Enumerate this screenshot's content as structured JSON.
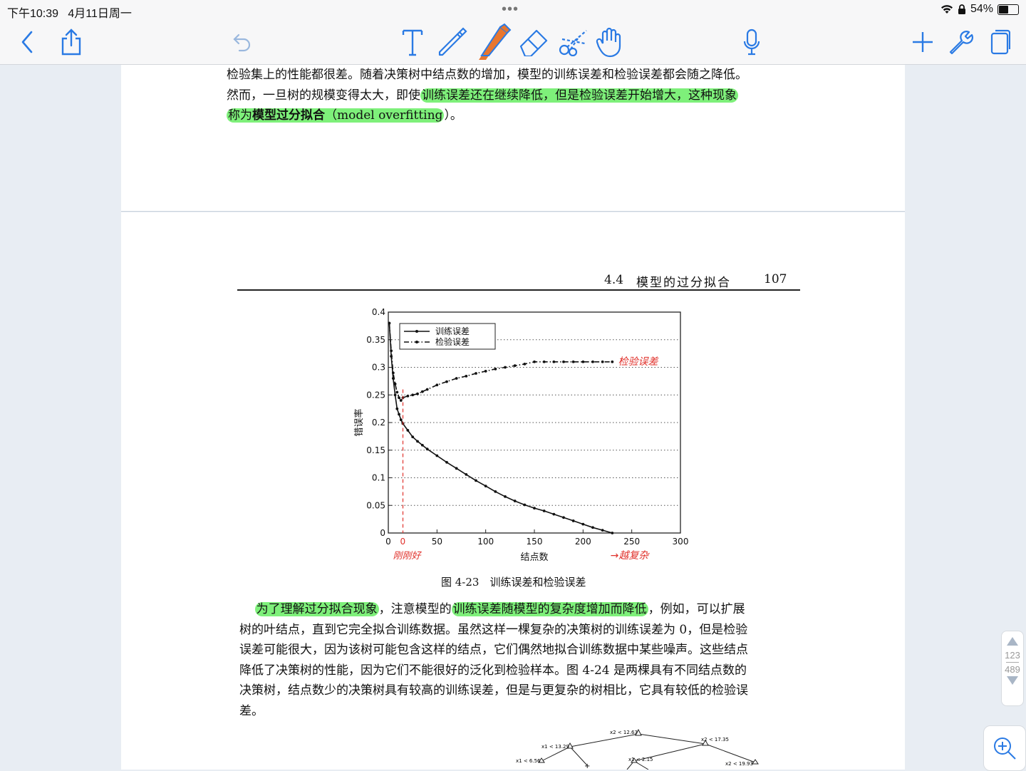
{
  "status_bar": {
    "time": "下午10:39",
    "date": "4月11日周一",
    "battery_percent": "54%",
    "battery_level": 0.54,
    "dots": "•••"
  },
  "toolbar": {
    "left": [
      "back-icon",
      "share-icon",
      "undo-icon"
    ],
    "tools": [
      "text-tool-icon",
      "pen-tool-icon",
      "highlighter-tool-icon",
      "eraser-tool-icon",
      "scissors-tool-icon",
      "hand-tool-icon"
    ],
    "mic": "microphone-icon",
    "right": [
      "add-icon",
      "wrench-icon",
      "pages-icon"
    ],
    "highlighter_color": "#e8762f"
  },
  "page1": {
    "line1": "检验集上的性能都很差。随着决策树中结点数的增加，模型的训练误差和检验误差都会随之降低。",
    "line2_pre": "然而，一旦树的规模变得太大，即使",
    "line2_hl": "训练误差还在继续降低，但是检验误差开始增大，这种现象",
    "line3_hl_a": "称为",
    "line3_hl_b": "模型过分拟合",
    "line3_hl_c": "（model overfitting",
    "line3_post": "）。"
  },
  "page2": {
    "section": "4.4",
    "section_title": "模型的过分拟合",
    "page_number": "107",
    "figure_caption": "图 4-23　训练误差和检验误差",
    "para_line1_hl1": "为了理解过分拟合现象",
    "para_line1_mid": "，注意模型的",
    "para_line1_hl2": "训练误差随模型的复杂度增加而降低",
    "para_line1_post": "，例如，可以扩展",
    "para_lines": [
      "树的叶结点，直到它完全拟合训练数据。虽然这样一棵复杂的决策树的训练误差为 0，但是检验",
      "误差可能很大，因为该树可能包含这样的结点，它们偶然地拟合训练数据中某些噪声。这些结点",
      "降低了决策树的性能，因为它们不能很好的泛化到检验样本。图 4-24 是两棵具有不同结点数的",
      "决策树，结点数少的决策树具有较高的训练误差，但是与更复杂的树相比，它具有较低的检验误",
      "差。"
    ],
    "tree_labels": [
      "x2 < 12.63",
      "x1 < 13.29",
      "x2 < 17.35",
      "x1 < 6.56",
      "x1 < 2.15",
      "x2 < 19.93"
    ]
  },
  "chart_data": {
    "type": "line",
    "xlabel": "结点数",
    "ylabel": "错误率",
    "xlim": [
      0,
      300
    ],
    "ylim": [
      0,
      0.4
    ],
    "xticks": [
      "0",
      "50",
      "100",
      "150",
      "200",
      "250",
      "300"
    ],
    "yticks": [
      "0",
      "0.05",
      "0.1",
      "0.15",
      "0.2",
      "0.25",
      "0.3",
      "0.35",
      "0.4"
    ],
    "grid": "horizontal dotted",
    "legend_position": "top-left",
    "series": [
      {
        "name": "训练误差",
        "style": "solid",
        "x": [
          1,
          3,
          5,
          7,
          9,
          11,
          13,
          15,
          20,
          25,
          30,
          35,
          40,
          50,
          60,
          70,
          80,
          90,
          100,
          110,
          120,
          130,
          140,
          150,
          160,
          170,
          180,
          190,
          200,
          210,
          220,
          230
        ],
        "y": [
          0.38,
          0.32,
          0.28,
          0.25,
          0.225,
          0.215,
          0.205,
          0.198,
          0.186,
          0.174,
          0.166,
          0.159,
          0.152,
          0.14,
          0.128,
          0.117,
          0.106,
          0.095,
          0.085,
          0.075,
          0.066,
          0.058,
          0.051,
          0.045,
          0.04,
          0.034,
          0.028,
          0.022,
          0.016,
          0.01,
          0.005,
          0.0
        ]
      },
      {
        "name": "检验误差",
        "style": "dash-dot",
        "x": [
          1,
          3,
          5,
          7,
          9,
          11,
          13,
          15,
          20,
          25,
          30,
          35,
          40,
          50,
          60,
          70,
          80,
          90,
          100,
          110,
          120,
          130,
          140,
          150,
          160,
          170,
          180,
          190,
          200,
          210,
          220,
          230
        ],
        "y": [
          0.38,
          0.33,
          0.29,
          0.27,
          0.255,
          0.245,
          0.24,
          0.245,
          0.248,
          0.25,
          0.252,
          0.256,
          0.26,
          0.268,
          0.274,
          0.28,
          0.284,
          0.289,
          0.293,
          0.297,
          0.3,
          0.303,
          0.306,
          0.31,
          0.31,
          0.31,
          0.31,
          0.31,
          0.31,
          0.31,
          0.31,
          0.31
        ]
      }
    ],
    "annotations": {
      "test_error": "检验误差",
      "just_right": "刚刚好",
      "more_complex": "→越复杂",
      "zero": "0",
      "vline_x": 15
    }
  },
  "page_nav": {
    "current": "123",
    "total": "489"
  }
}
